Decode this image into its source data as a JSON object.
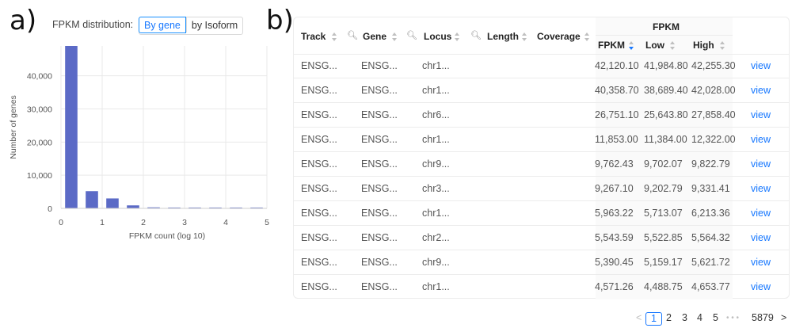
{
  "panel_a": {
    "letter": "a)",
    "dist_label": "FPKM distribution:",
    "toggle": {
      "active": "By gene",
      "inactive": "by Isoform"
    }
  },
  "panel_b": {
    "letter": "b)"
  },
  "chart_data": {
    "type": "bar",
    "xlabel": "FPKM count (log 10)",
    "ylabel": "Number of genes",
    "xlim": [
      0,
      5
    ],
    "ylim": [
      0,
      49000
    ],
    "x_ticks": [
      "0",
      "1",
      "2",
      "3",
      "4",
      "5"
    ],
    "y_ticks": [
      "0",
      "10,000",
      "20,000",
      "30,000",
      "40,000"
    ],
    "bar_width": 0.3,
    "bar_color": "#5b6ac6",
    "bins": [
      {
        "x": 0.25,
        "value": 49000
      },
      {
        "x": 0.75,
        "value": 5200
      },
      {
        "x": 1.25,
        "value": 3000
      },
      {
        "x": 1.75,
        "value": 900
      },
      {
        "x": 2.25,
        "value": 300
      },
      {
        "x": 2.75,
        "value": 250
      },
      {
        "x": 3.25,
        "value": 250
      },
      {
        "x": 3.75,
        "value": 250
      },
      {
        "x": 4.25,
        "value": 250
      },
      {
        "x": 4.75,
        "value": 250
      }
    ]
  },
  "table": {
    "group_header": "FPKM",
    "headers": {
      "track": "Track",
      "gene": "Gene",
      "locus": "Locus",
      "length": "Length",
      "coverage": "Coverage",
      "fpkm": "FPKM",
      "low": "Low",
      "high": "High"
    },
    "rows": [
      {
        "track": "ENSG...",
        "gene": "ENSG...",
        "locus": "chr1...",
        "fpkm": "42,120.10",
        "low": "41,984.80",
        "high": "42,255.30",
        "action": "view"
      },
      {
        "track": "ENSG...",
        "gene": "ENSG...",
        "locus": "chr1...",
        "fpkm": "40,358.70",
        "low": "38,689.40",
        "high": "42,028.00",
        "action": "view"
      },
      {
        "track": "ENSG...",
        "gene": "ENSG...",
        "locus": "chr6...",
        "fpkm": "26,751.10",
        "low": "25,643.80",
        "high": "27,858.40",
        "action": "view"
      },
      {
        "track": "ENSG...",
        "gene": "ENSG...",
        "locus": "chr1...",
        "fpkm": "11,853.00",
        "low": "11,384.00",
        "high": "12,322.00",
        "action": "view"
      },
      {
        "track": "ENSG...",
        "gene": "ENSG...",
        "locus": "chr9...",
        "fpkm": "9,762.43",
        "low": "9,702.07",
        "high": "9,822.79",
        "action": "view"
      },
      {
        "track": "ENSG...",
        "gene": "ENSG...",
        "locus": "chr3...",
        "fpkm": "9,267.10",
        "low": "9,202.79",
        "high": "9,331.41",
        "action": "view"
      },
      {
        "track": "ENSG...",
        "gene": "ENSG...",
        "locus": "chr1...",
        "fpkm": "5,963.22",
        "low": "5,713.07",
        "high": "6,213.36",
        "action": "view"
      },
      {
        "track": "ENSG...",
        "gene": "ENSG...",
        "locus": "chr2...",
        "fpkm": "5,543.59",
        "low": "5,522.85",
        "high": "5,564.32",
        "action": "view"
      },
      {
        "track": "ENSG...",
        "gene": "ENSG...",
        "locus": "chr9...",
        "fpkm": "5,390.45",
        "low": "5,159.17",
        "high": "5,621.72",
        "action": "view"
      },
      {
        "track": "ENSG...",
        "gene": "ENSG...",
        "locus": "chr1...",
        "fpkm": "4,571.26",
        "low": "4,488.75",
        "high": "4,653.77",
        "action": "view"
      }
    ]
  },
  "pagination": {
    "prev": "<",
    "current": "1",
    "pages": [
      "2",
      "3",
      "4",
      "5"
    ],
    "ellipsis": "• • •",
    "last": "5879",
    "next": ">"
  },
  "colors": {
    "accent": "#1677ff",
    "bar": "#5b6ac6"
  }
}
